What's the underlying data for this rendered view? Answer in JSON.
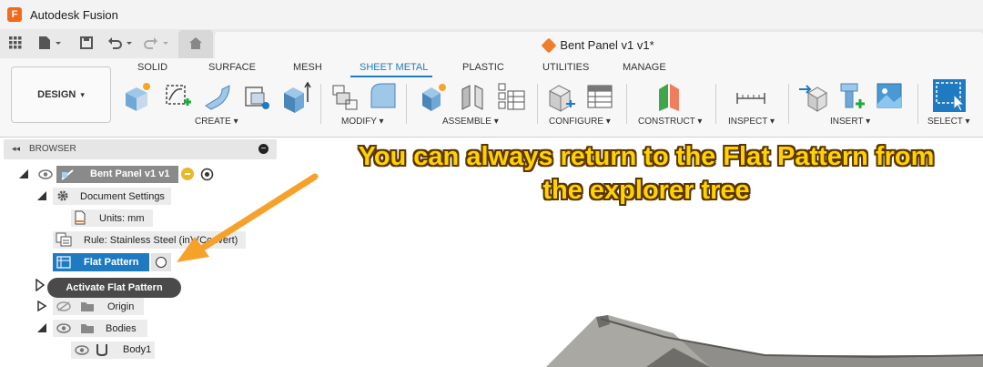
{
  "window": {
    "app_title": "Autodesk Fusion",
    "doc_title": "Bent Panel v1 v1*"
  },
  "workspace": {
    "label": "DESIGN",
    "dropdown_arrow": "▾"
  },
  "ribbon": {
    "tabs": [
      {
        "label": "SOLID",
        "active": false
      },
      {
        "label": "SURFACE",
        "active": false
      },
      {
        "label": "MESH",
        "active": false
      },
      {
        "label": "SHEET METAL",
        "active": true
      },
      {
        "label": "PLASTIC",
        "active": false
      },
      {
        "label": "UTILITIES",
        "active": false
      },
      {
        "label": "MANAGE",
        "active": false
      }
    ],
    "groups": [
      {
        "label": "CREATE ▾"
      },
      {
        "label": "MODIFY ▾"
      },
      {
        "label": "ASSEMBLE ▾"
      },
      {
        "label": "CONFIGURE ▾"
      },
      {
        "label": "CONSTRUCT ▾"
      },
      {
        "label": "INSPECT ▾"
      },
      {
        "label": "INSERT ▾"
      },
      {
        "label": "SELECT ▾"
      }
    ]
  },
  "browser": {
    "title": "BROWSER",
    "collapse_icon": "◂◂",
    "minus": "−",
    "nodes": {
      "root": "Bent Panel v1 v1",
      "document_settings": "Document Settings",
      "units": "Units: mm",
      "rule": "Rule: Stainless Steel (in) (Convert)",
      "flat_pattern": "Flat Pattern",
      "origin": "Origin",
      "bodies": "Bodies",
      "body1": "Body1"
    }
  },
  "tooltip": "Activate Flat Pattern",
  "annotation": {
    "line1": "You can always return to the Flat Pattern from",
    "line2": "the explorer tree"
  },
  "colors": {
    "accent": "#1f7bc1",
    "annotation_text": "#ffd200",
    "arrow": "#f5a12a"
  }
}
